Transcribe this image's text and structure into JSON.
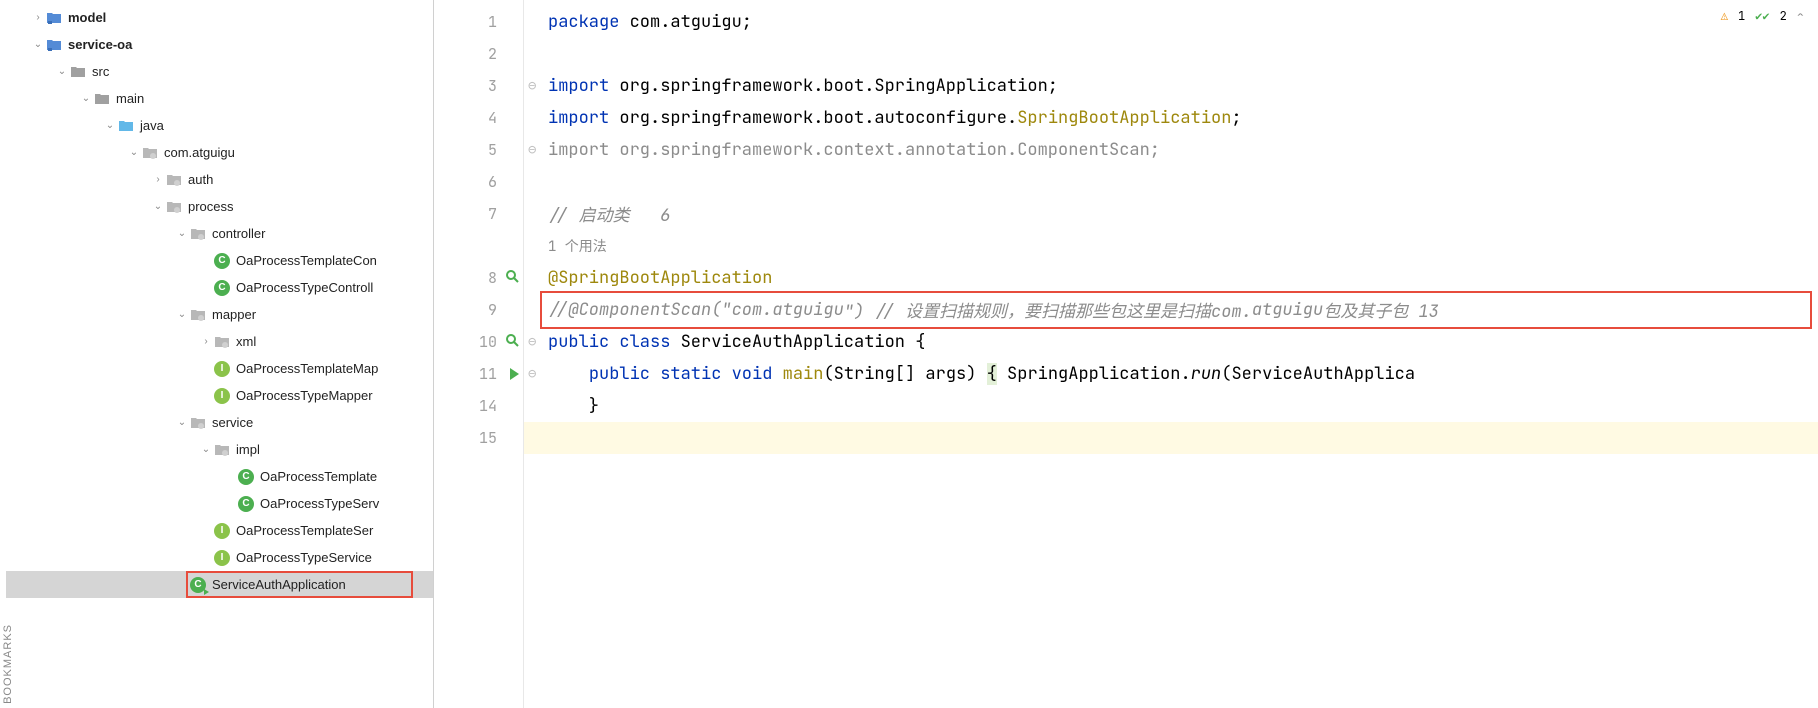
{
  "sidebar": {
    "bookmarks_label": "BOOKMARKS",
    "items": [
      {
        "depth": 1,
        "chev": "right",
        "icon": "folder-blue",
        "label": "model",
        "bold": true
      },
      {
        "depth": 1,
        "chev": "down",
        "icon": "folder-blue",
        "label": "service-oa",
        "bold": true
      },
      {
        "depth": 2,
        "chev": "down",
        "icon": "folder-gray",
        "label": "src"
      },
      {
        "depth": 3,
        "chev": "down",
        "icon": "folder-gray",
        "label": "main"
      },
      {
        "depth": 4,
        "chev": "down",
        "icon": "folder-cyan",
        "label": "java"
      },
      {
        "depth": 5,
        "chev": "down",
        "icon": "pkg",
        "label": "com.atguigu"
      },
      {
        "depth": 6,
        "chev": "right",
        "icon": "pkg",
        "label": "auth"
      },
      {
        "depth": 6,
        "chev": "down",
        "icon": "pkg",
        "label": "process"
      },
      {
        "depth": 7,
        "chev": "down",
        "icon": "pkg",
        "label": "controller"
      },
      {
        "depth": 8,
        "chev": "none",
        "icon": "class-c",
        "label": "OaProcessTemplateCon"
      },
      {
        "depth": 8,
        "chev": "none",
        "icon": "class-c",
        "label": "OaProcessTypeControll"
      },
      {
        "depth": 7,
        "chev": "down",
        "icon": "pkg",
        "label": "mapper"
      },
      {
        "depth": 8,
        "chev": "right",
        "icon": "pkg",
        "label": "xml"
      },
      {
        "depth": 8,
        "chev": "none",
        "icon": "class-i",
        "label": "OaProcessTemplateMap"
      },
      {
        "depth": 8,
        "chev": "none",
        "icon": "class-i",
        "label": "OaProcessTypeMapper"
      },
      {
        "depth": 7,
        "chev": "down",
        "icon": "pkg",
        "label": "service"
      },
      {
        "depth": 8,
        "chev": "down",
        "icon": "pkg",
        "label": "impl"
      },
      {
        "depth": 9,
        "chev": "none",
        "icon": "class-c",
        "label": "OaProcessTemplate"
      },
      {
        "depth": 9,
        "chev": "none",
        "icon": "class-c",
        "label": "OaProcessTypeServ"
      },
      {
        "depth": 8,
        "chev": "none",
        "icon": "class-i",
        "label": "OaProcessTemplateSer"
      },
      {
        "depth": 8,
        "chev": "none",
        "icon": "class-i",
        "label": "OaProcessTypeService"
      },
      {
        "depth": 7,
        "chev": "none",
        "icon": "class-c-run",
        "label": "ServiceAuthApplication",
        "selected": true,
        "highlighted": true
      }
    ]
  },
  "editor": {
    "usages_text": "1 个用法",
    "lines": [
      {
        "n": 1,
        "seg": [
          {
            "t": "package ",
            "c": "kw"
          },
          {
            "t": "com.atguigu;"
          }
        ]
      },
      {
        "n": 2,
        "seg": []
      },
      {
        "n": 3,
        "fold": "-",
        "seg": [
          {
            "t": "import ",
            "c": "kw"
          },
          {
            "t": "org.springframework.boot.SpringApplication;"
          }
        ]
      },
      {
        "n": 4,
        "seg": [
          {
            "t": "import ",
            "c": "kw"
          },
          {
            "t": "org.springframework.boot.autoconfigure."
          },
          {
            "t": "SpringBootApplication",
            "c": "cls"
          },
          {
            "t": ";"
          }
        ]
      },
      {
        "n": 5,
        "fold": "-",
        "seg": [
          {
            "t": "import ",
            "c": "graycode"
          },
          {
            "t": "org.springframework.context.annotation.ComponentScan;",
            "c": "graycode"
          }
        ]
      },
      {
        "n": 6,
        "seg": []
      },
      {
        "n": 7,
        "seg": [
          {
            "t": "// 启动类   6",
            "c": "cmt"
          }
        ]
      },
      {
        "n": "",
        "usages": true,
        "seg": []
      },
      {
        "n": 8,
        "gicon": "search",
        "seg": [
          {
            "t": "@SpringBootApplication",
            "c": "an"
          }
        ]
      },
      {
        "n": 9,
        "redbox": true,
        "seg": [
          {
            "t": "//@ComponentScan(\"com.",
            "c": "cmt"
          },
          {
            "t": "atguigu",
            "c": "cmt"
          },
          {
            "t": "\") // 设置扫描规则，要扫描那些包这里是扫描com.",
            "c": "cmt"
          },
          {
            "t": "atguigu",
            "c": "cmt"
          },
          {
            "t": "包及其子包 13",
            "c": "cmt"
          }
        ]
      },
      {
        "n": 10,
        "gicon": "search",
        "fold": "-",
        "seg": [
          {
            "t": "public class ",
            "c": "kw"
          },
          {
            "t": "ServiceAuthApplication {"
          }
        ]
      },
      {
        "n": 11,
        "gicon": "run",
        "fold": "-",
        "seg": [
          {
            "t": "    "
          },
          {
            "t": "public static void ",
            "c": "kw"
          },
          {
            "t": "main",
            "c": "an"
          },
          {
            "t": "(String[] args) "
          },
          {
            "t": "{",
            "bg": "#e3f0d8"
          },
          {
            "t": " SpringApplication."
          },
          {
            "t": "run",
            "c": "fn"
          },
          {
            "t": "(ServiceAuthApplica"
          }
        ]
      },
      {
        "n": 14,
        "seg": [
          {
            "t": "    }"
          }
        ]
      },
      {
        "n": 15,
        "cursor": true,
        "seg": []
      }
    ]
  },
  "inspection": {
    "warnings": "1",
    "passed": "2"
  }
}
